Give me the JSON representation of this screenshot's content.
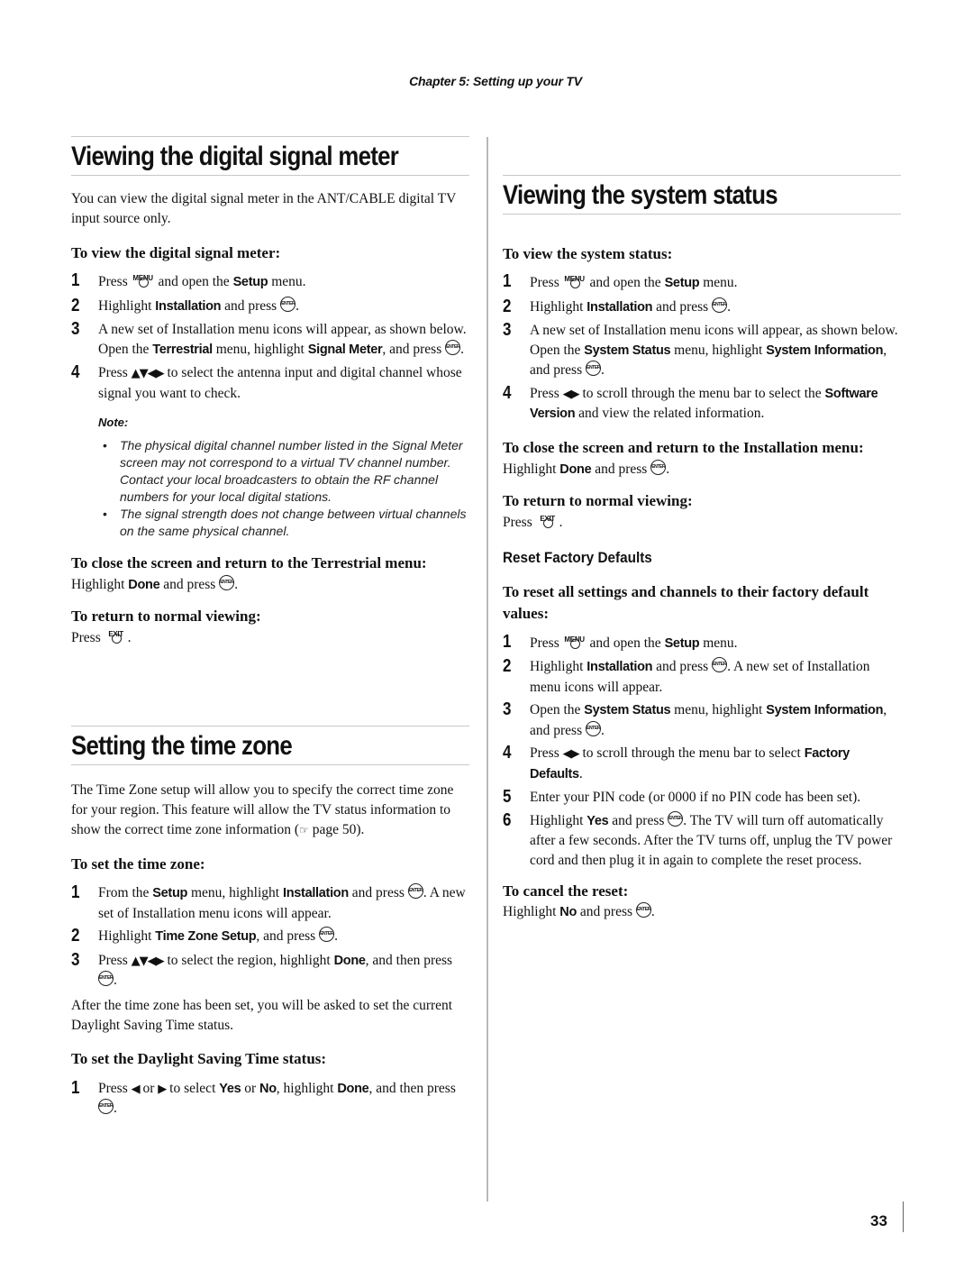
{
  "running_head": "Chapter 5: Setting up your TV",
  "page_number": "33",
  "icons": {
    "enter": "ENTER",
    "menu": "MENU",
    "exit": "EXIT",
    "arrows_all": "▲▼◀▶",
    "arrows_lr": "◀▶",
    "arrow_left": "◀",
    "arrow_right": "▶",
    "page_ref": "☞"
  },
  "signal_meter": {
    "title": "Viewing the digital signal meter",
    "intro": "You can view the digital signal meter in the ANT/CABLE digital TV input source only.",
    "procedure_heading": "To view the digital signal meter:",
    "steps": [
      {
        "num": "1",
        "t1": "Press ",
        "t2": " and open the ",
        "b1": "Setup",
        "t3": " menu."
      },
      {
        "num": "2",
        "t1": "Highlight ",
        "b1": "Installation",
        "t2": " and press ",
        "t3": "."
      },
      {
        "num": "3",
        "t1": "A new set of Installation menu icons will appear, as shown below. Open the ",
        "b1": "Terrestrial",
        "t2": " menu, highlight ",
        "b2": "Signal Meter",
        "t3": ", and press ",
        "t4": "."
      },
      {
        "num": "4",
        "t1": "Press ",
        "t2": " to select the antenna input and digital channel whose signal you want to check."
      }
    ],
    "note_title": "Note:",
    "notes": [
      "The physical digital channel number listed in the Signal Meter screen may not correspond to a virtual TV channel number. Contact your local broadcasters to obtain the RF channel numbers for your local digital stations.",
      "The signal strength does not change between virtual channels on the same physical channel."
    ],
    "close_heading": "To close the screen and return to the Terrestrial menu:",
    "close_t1": "Highlight ",
    "close_b1": "Done",
    "close_t2": " and press ",
    "close_t3": ".",
    "return_heading": "To return to normal viewing:",
    "return_t1": "Press ",
    "return_t2": "."
  },
  "time_zone": {
    "title": "Setting the time zone",
    "intro_t1": "The Time Zone setup will allow you to specify the correct time zone for your region. This feature will allow the TV status information to show the correct time zone information (",
    "intro_t2": " page 50).",
    "procedure_heading": "To set the time zone:",
    "steps": [
      {
        "num": "1",
        "t1": "From the ",
        "b1": "Setup",
        "t2": " menu, highlight ",
        "b2": "Installation",
        "t3": " and press ",
        "t4": ". A new set of Installation menu icons will appear."
      },
      {
        "num": "2",
        "t1": "Highlight ",
        "b1": "Time Zone Setup",
        "t2": ", and press ",
        "t3": "."
      },
      {
        "num": "3",
        "t1": "Press ",
        "t2": " to select the region, highlight ",
        "b1": "Done",
        "t3": ", and then press ",
        "t4": "."
      }
    ],
    "after": "After the time zone has been set, you will be asked to set the current Daylight Saving Time status.",
    "dst_heading": "To set the Daylight Saving Time status:",
    "dst_step": {
      "num": "1",
      "t1": "Press ",
      "t2": " or ",
      "t3": " to select ",
      "b1": "Yes",
      "t4": " or ",
      "b2": "No",
      "t5": ", highlight ",
      "b3": "Done",
      "t6": ", and then press ",
      "t7": "."
    }
  },
  "system_status": {
    "title": "Viewing the system status",
    "procedure_heading": "To view the system status:",
    "steps": [
      {
        "num": "1",
        "t1": "Press ",
        "t2": " and open the ",
        "b1": "Setup",
        "t3": " menu."
      },
      {
        "num": "2",
        "t1": "Highlight ",
        "b1": "Installation",
        "t2": " and press ",
        "t3": "."
      },
      {
        "num": "3",
        "t1": "A new set of Installation menu icons will appear, as shown below. Open the ",
        "b1": "System Status",
        "t2": " menu, highlight ",
        "b2": "System Information",
        "t3": ", and press ",
        "t4": "."
      },
      {
        "num": "4",
        "t1": "Press ",
        "t2": " to scroll through the menu bar to select the ",
        "b1": "Software Version",
        "t3": " and view the related information."
      }
    ],
    "close_heading": "To close the screen and return to the Installation menu:",
    "close_t1": "Highlight ",
    "close_b1": "Done",
    "close_t2": " and press ",
    "close_t3": ".",
    "return_heading": "To return to normal viewing:",
    "return_t1": "Press ",
    "return_t2": "."
  },
  "factory_reset": {
    "title": "Reset Factory Defaults",
    "procedure_heading": "To reset all settings and channels to their factory default values:",
    "steps": [
      {
        "num": "1",
        "t1": "Press ",
        "t2": " and open the ",
        "b1": "Setup",
        "t3": " menu."
      },
      {
        "num": "2",
        "t1": "Highlight ",
        "b1": "Installation",
        "t2": " and press ",
        "t3": ". A new set of Installation menu icons will appear."
      },
      {
        "num": "3",
        "t1": "Open the ",
        "b1": "System Status",
        "t2": " menu, highlight ",
        "b2": "System Information",
        "t3": ", and press ",
        "t4": "."
      },
      {
        "num": "4",
        "t1": "Press ",
        "t2": " to scroll through the menu bar to select ",
        "b1": "Factory Defaults",
        "t3": "."
      },
      {
        "num": "5",
        "t1": "Enter your PIN code (or 0000 if no PIN code has been set)."
      },
      {
        "num": "6",
        "t1": "Highlight ",
        "b1": "Yes",
        "t2": " and press ",
        "t3": ". The TV will turn off automatically after a few seconds. After the TV turns off, unplug the TV power cord and then plug it in again to complete the reset process."
      }
    ],
    "cancel_heading": "To cancel the reset:",
    "cancel_t1": "Highlight ",
    "cancel_b1": "No",
    "cancel_t2": " and press ",
    "cancel_t3": "."
  }
}
